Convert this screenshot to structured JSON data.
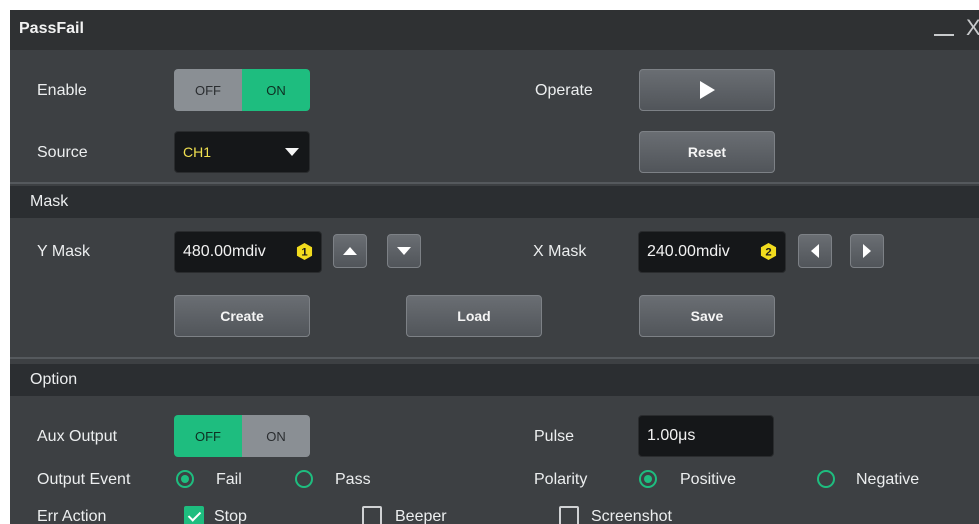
{
  "window": {
    "title": "PassFail",
    "minimize_glyph": "—",
    "close_glyph": "X"
  },
  "enable": {
    "label": "Enable",
    "off": "OFF",
    "on": "ON",
    "state": "ON"
  },
  "operate": {
    "label": "Operate",
    "icon": "play-icon"
  },
  "source": {
    "label": "Source",
    "value": "CH1"
  },
  "reset": {
    "label": "Reset"
  },
  "mask": {
    "header": "Mask",
    "y_label": "Y Mask",
    "y_value": "480.00mdiv",
    "y_badge": "1",
    "x_label": "X Mask",
    "x_value": "240.00mdiv",
    "x_badge": "2",
    "create": "Create",
    "load": "Load",
    "save": "Save"
  },
  "option": {
    "header": "Option",
    "aux_label": "Aux Output",
    "aux_off": "OFF",
    "aux_on": "ON",
    "aux_state": "OFF",
    "pulse_label": "Pulse",
    "pulse_value": "1.00μs",
    "event_label": "Output Event",
    "event_fail": "Fail",
    "event_pass": "Pass",
    "event_selected": "Fail",
    "polarity_label": "Polarity",
    "polarity_positive": "Positive",
    "polarity_negative": "Negative",
    "polarity_selected": "Positive",
    "err_label": "Err Action",
    "err_stop": "Stop",
    "err_beeper": "Beeper",
    "err_screenshot": "Screenshot",
    "err_checked": [
      "Stop"
    ]
  },
  "colors": {
    "accent": "#1ebd7f",
    "badge": "#f2dc1e",
    "panel": "#3d4043",
    "section": "#2b2e31"
  }
}
